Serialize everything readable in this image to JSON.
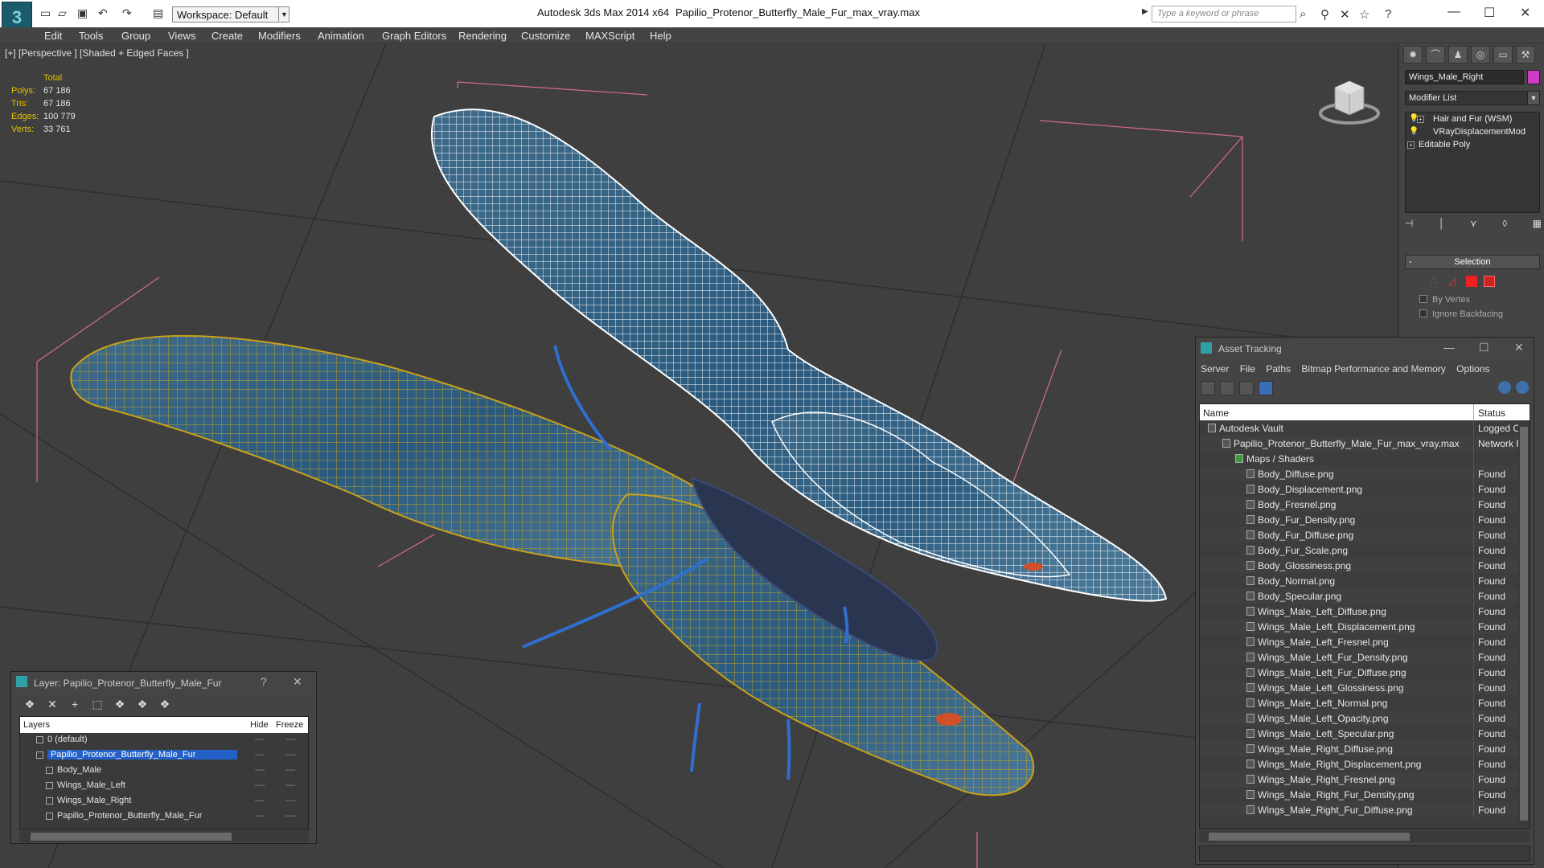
{
  "titlebar": {
    "workspace": "Workspace: Default",
    "app_title": "Autodesk 3ds Max  2014 x64",
    "file_title": "Papilio_Protenor_Butterfly_Male_Fur_max_vray.max",
    "search_placeholder": "Type a keyword or phrase"
  },
  "menu": [
    "Edit",
    "Tools",
    "Group",
    "Views",
    "Create",
    "Modifiers",
    "Animation",
    "Graph Editors",
    "Rendering",
    "Customize",
    "MAXScript",
    "Help"
  ],
  "viewport": {
    "label": "[+] [Perspective ] [Shaded + Edged Faces ]",
    "stats": {
      "header": "Total",
      "polys_label": "Polys:",
      "polys": "67 186",
      "tris_label": "Tris:",
      "tris": "67 186",
      "edges_label": "Edges:",
      "edges": "100 779",
      "verts_label": "Verts:",
      "verts": "33 761"
    }
  },
  "command_panel": {
    "object_name": "Wings_Male_Right",
    "object_color": "#d03cc6",
    "modifier_list": "Modifier List",
    "stack": [
      "Hair and Fur (WSM)",
      "VRayDisplacementMod",
      "Editable Poly"
    ],
    "rollout_title": "Selection",
    "by_vertex": "By Vertex",
    "ignore_backfacing": "Ignore Backfacing"
  },
  "asset_tracking": {
    "title": "Asset Tracking",
    "menu": [
      "Server",
      "File",
      "Paths",
      "Bitmap Performance and Memory",
      "Options"
    ],
    "col_name": "Name",
    "col_status": "Status",
    "rows": [
      {
        "name": "Autodesk Vault",
        "status": "Logged O",
        "level": 0
      },
      {
        "name": "Papilio_Protenor_Butterfly_Male_Fur_max_vray.max",
        "status": "Network P",
        "level": 1
      },
      {
        "name": "Maps / Shaders",
        "status": "",
        "level": 2
      },
      {
        "name": "Body_Diffuse.png",
        "status": "Found",
        "level": 3
      },
      {
        "name": "Body_Displacement.png",
        "status": "Found",
        "level": 3
      },
      {
        "name": "Body_Fresnel.png",
        "status": "Found",
        "level": 3
      },
      {
        "name": "Body_Fur_Density.png",
        "status": "Found",
        "level": 3
      },
      {
        "name": "Body_Fur_Diffuse.png",
        "status": "Found",
        "level": 3
      },
      {
        "name": "Body_Fur_Scale.png",
        "status": "Found",
        "level": 3
      },
      {
        "name": "Body_Glossiness.png",
        "status": "Found",
        "level": 3
      },
      {
        "name": "Body_Normal.png",
        "status": "Found",
        "level": 3
      },
      {
        "name": "Body_Specular.png",
        "status": "Found",
        "level": 3
      },
      {
        "name": "Wings_Male_Left_Diffuse.png",
        "status": "Found",
        "level": 3
      },
      {
        "name": "Wings_Male_Left_Displacement.png",
        "status": "Found",
        "level": 3
      },
      {
        "name": "Wings_Male_Left_Fresnel.png",
        "status": "Found",
        "level": 3
      },
      {
        "name": "Wings_Male_Left_Fur_Density.png",
        "status": "Found",
        "level": 3
      },
      {
        "name": "Wings_Male_Left_Fur_Diffuse.png",
        "status": "Found",
        "level": 3
      },
      {
        "name": "Wings_Male_Left_Glossiness.png",
        "status": "Found",
        "level": 3
      },
      {
        "name": "Wings_Male_Left_Normal.png",
        "status": "Found",
        "level": 3
      },
      {
        "name": "Wings_Male_Left_Opacity.png",
        "status": "Found",
        "level": 3
      },
      {
        "name": "Wings_Male_Left_Specular.png",
        "status": "Found",
        "level": 3
      },
      {
        "name": "Wings_Male_Right_Diffuse.png",
        "status": "Found",
        "level": 3
      },
      {
        "name": "Wings_Male_Right_Displacement.png",
        "status": "Found",
        "level": 3
      },
      {
        "name": "Wings_Male_Right_Fresnel.png",
        "status": "Found",
        "level": 3
      },
      {
        "name": "Wings_Male_Right_Fur_Density.png",
        "status": "Found",
        "level": 3
      },
      {
        "name": "Wings_Male_Right_Fur_Diffuse.png",
        "status": "Found",
        "level": 3
      }
    ]
  },
  "layer_manager": {
    "title": "Layer: Papilio_Protenor_Butterfly_Male_Fur",
    "col_layers": "Layers",
    "col_hide": "Hide",
    "col_freeze": "Freeze",
    "rows": [
      {
        "name": "0 (default)",
        "level": 0,
        "selected": false
      },
      {
        "name": "Papilio_Protenor_Butterfly_Male_Fur",
        "level": 0,
        "selected": true
      },
      {
        "name": "Body_Male",
        "level": 1,
        "selected": false
      },
      {
        "name": "Wings_Male_Left",
        "level": 1,
        "selected": false
      },
      {
        "name": "Wings_Male_Right",
        "level": 1,
        "selected": false
      },
      {
        "name": "Papilio_Protenor_Butterfly_Male_Fur",
        "level": 1,
        "selected": false
      }
    ]
  }
}
